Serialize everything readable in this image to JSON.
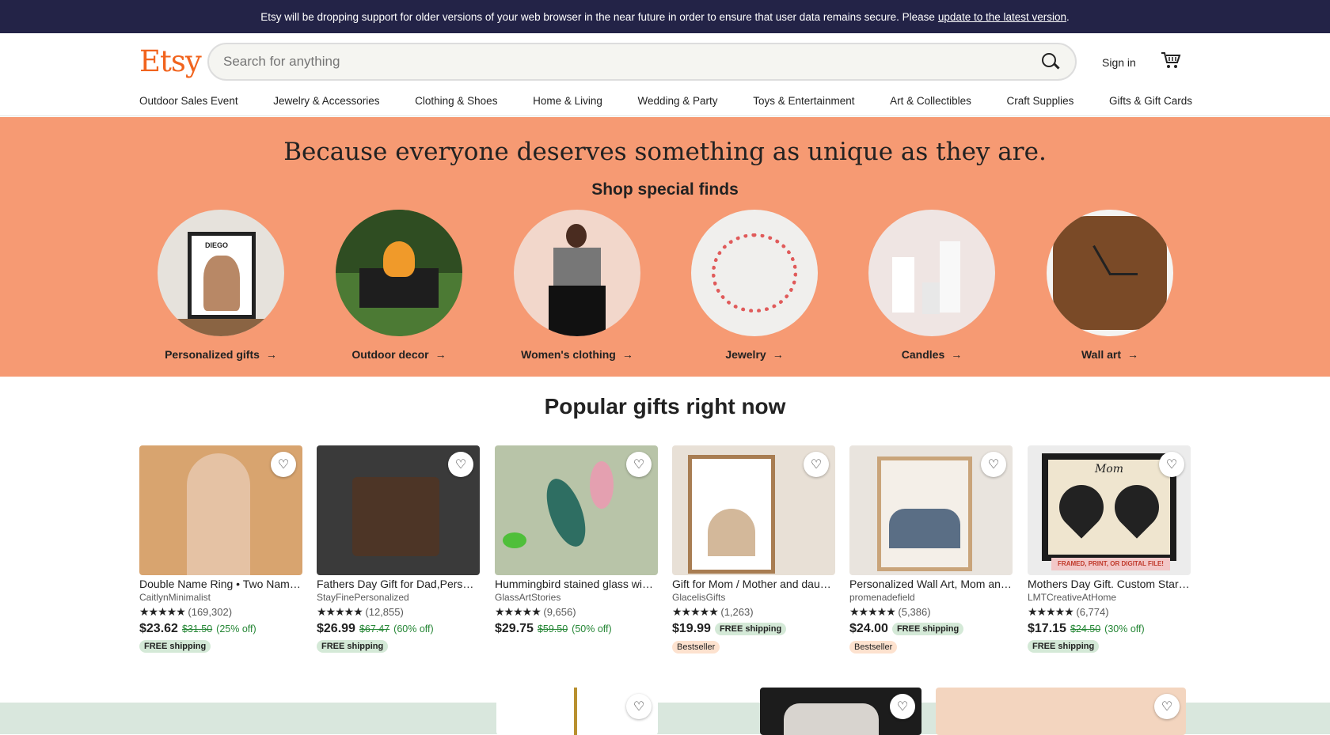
{
  "banner": {
    "text": "Etsy will be dropping support for older versions of your web browser in the near future in order to ensure that user data remains secure. Please",
    "link": "update to the latest version",
    "end": "."
  },
  "header": {
    "logo": "Etsy",
    "search_placeholder": "Search for anything",
    "signin": "Sign in"
  },
  "nav": [
    "Outdoor Sales Event",
    "Jewelry & Accessories",
    "Clothing & Shoes",
    "Home & Living",
    "Wedding & Party",
    "Toys & Entertainment",
    "Art & Collectibles",
    "Craft Supplies",
    "Gifts & Gift Cards"
  ],
  "hero": {
    "title": "Because everyone deserves something as unique as they are.",
    "subtitle": "Shop special finds",
    "categories": [
      "Personalized gifts",
      "Outdoor decor",
      "Women's clothing",
      "Jewelry",
      "Candles",
      "Wall art"
    ],
    "circle_image_text": "DIEGO"
  },
  "popular": {
    "title": "Popular gifts right now",
    "items": [
      {
        "title": "Double Name Ring • Two Name Ring • Couple...",
        "shop": "CaitlynMinimalist",
        "rating": "(169,302)",
        "price": "$23.62",
        "orig": "$31.50",
        "disc": "(25% off)",
        "free": "FREE shipping",
        "best": ""
      },
      {
        "title": "Fathers Day Gift for Dad,Personalized Wallet...",
        "shop": "StayFinePersonalized",
        "rating": "(12,855)",
        "price": "$26.99",
        "orig": "$67.47",
        "disc": "(60% off)",
        "free": "FREE shipping",
        "best": ""
      },
      {
        "title": "Hummingbird stained glass window hangings...",
        "shop": "GlassArtStories",
        "rating": "(9,656)",
        "price": "$29.75",
        "orig": "$59.50",
        "disc": "(50% off)",
        "free": "",
        "best": ""
      },
      {
        "title": "Gift for Mom / Mother and daughter print...",
        "shop": "GlacelisGifts",
        "rating": "(1,263)",
        "price": "$19.99",
        "orig": "",
        "disc": "",
        "free": "FREE shipping",
        "best": "Bestseller"
      },
      {
        "title": "Personalized Wall Art, Mom and Daughters...",
        "shop": "promenadefield",
        "rating": "(5,386)",
        "price": "$24.00",
        "orig": "",
        "disc": "",
        "free": "FREE shipping",
        "best": "Bestseller"
      },
      {
        "title": "Mothers Day Gift. Custom Star Map...",
        "shop": "LMTCreativeAtHome",
        "rating": "(6,774)",
        "price": "$17.15",
        "orig": "$24.50",
        "disc": "(30% off)",
        "free": "FREE shipping",
        "best": ""
      }
    ],
    "stars": "★★★★★",
    "card3_image_text": "Mom",
    "card3_image_banner": "FRAMED, PRINT, OR DIGITAL FILE!"
  },
  "icons": {
    "heart": "♡",
    "arrow": "→"
  },
  "colors": {
    "accent": "#f1641e",
    "hero": "#f69a73",
    "banner": "#232347"
  }
}
